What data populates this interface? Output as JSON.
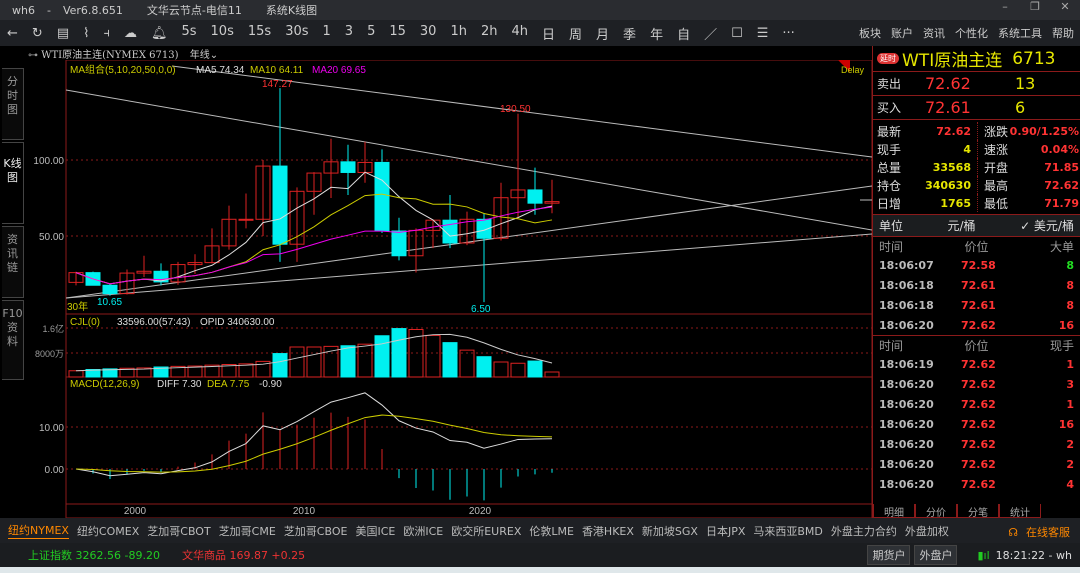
{
  "window": {
    "app": "wh6",
    "version": "Ver6.8.651",
    "server": "文华云节点-电信11",
    "view": "系统K线图"
  },
  "toolbar": {
    "periods": [
      "5s",
      "10s",
      "15s",
      "30s",
      "1",
      "3",
      "5",
      "15",
      "30",
      "1h",
      "2h",
      "4h",
      "日",
      "周",
      "月",
      "季",
      "年",
      "自"
    ],
    "menu": [
      "板块",
      "账户",
      "资讯",
      "个性化",
      "系统工具",
      "帮助"
    ]
  },
  "sidebar": {
    "tabs": [
      "分时图",
      "K线图",
      "资讯链",
      "F10资料"
    ]
  },
  "chart": {
    "symbol": "WTI原油主连(NYMEX 6713)",
    "period": "年线",
    "delay": "Delay",
    "ma_label": "MA组合(5,10,20,50,0,0)",
    "ma5": "MA5 74.34",
    "ma10": "MA10 64.11",
    "ma20": "MA20 69.65",
    "high_label": "147.27",
    "high2_label": "130.50",
    "low_label": "10.65",
    "low2_label": "6.50",
    "span": "30年",
    "y_ticks": [
      "100.00",
      "50.00"
    ],
    "vol_label": "CJL(0)",
    "vol_info": "33596.00(57:43)",
    "opid": "OPID 340630.00",
    "vol_ticks": [
      "1.6亿",
      "8000万"
    ],
    "macd_label": "MACD(12,26,9)",
    "diff": "DIFF 7.30",
    "dea": "DEA 7.75",
    "macd": "-0.90",
    "macd_ticks": [
      "10.00",
      "0.00"
    ],
    "x_ticks": [
      "2000",
      "2010",
      "2020"
    ],
    "colors": {
      "up": "#d22",
      "down": "#00f0f0",
      "ma5": "#ddd",
      "ma10": "#cccc00",
      "ma20": "#e0e"
    }
  },
  "chart_data": {
    "type": "candlestick",
    "years": [
      1996,
      1997,
      1998,
      1999,
      2000,
      2001,
      2002,
      2003,
      2004,
      2005,
      2006,
      2007,
      2008,
      2009,
      2010,
      2011,
      2012,
      2013,
      2014,
      2015,
      2016,
      2017,
      2018,
      2019,
      2020,
      2021,
      2022,
      2023,
      2024
    ],
    "ohlc": [
      [
        19.5,
        26.5,
        17.5,
        25.9
      ],
      [
        25.9,
        26.6,
        17.8,
        17.6
      ],
      [
        17.6,
        18,
        10.65,
        12.1
      ],
      [
        12.1,
        28,
        11.5,
        25.6
      ],
      [
        25.6,
        37,
        23,
        26.8
      ],
      [
        26.8,
        32,
        17.5,
        19.8
      ],
      [
        19.8,
        33,
        17.9,
        31.2
      ],
      [
        31.2,
        38,
        25,
        32.5
      ],
      [
        32.5,
        55,
        32,
        43.5
      ],
      [
        43.5,
        70,
        41,
        61
      ],
      [
        61,
        78,
        55,
        61
      ],
      [
        61,
        100,
        50,
        96
      ],
      [
        96,
        147.27,
        33,
        44.6
      ],
      [
        44.6,
        82,
        33,
        79.4
      ],
      [
        79.4,
        92,
        64,
        91.4
      ],
      [
        91.4,
        114,
        75,
        98.8
      ],
      [
        98.8,
        110,
        77,
        91.8
      ],
      [
        91.8,
        112,
        85,
        98.4
      ],
      [
        98.4,
        107,
        52,
        53.3
      ],
      [
        53.3,
        62,
        34,
        37
      ],
      [
        37,
        55,
        26,
        53.7
      ],
      [
        53.7,
        60,
        42,
        60.4
      ],
      [
        60.4,
        77,
        42,
        45.4
      ],
      [
        45.4,
        66,
        44,
        61
      ],
      [
        61,
        65,
        6.5,
        48.5
      ],
      [
        48.5,
        85,
        47,
        75.2
      ],
      [
        75.2,
        130.5,
        62,
        80.3
      ],
      [
        80.3,
        95,
        64,
        71.6
      ],
      [
        71.6,
        87,
        65,
        72.62
      ]
    ],
    "volume_wan": [
      2000,
      2400,
      2600,
      2800,
      2900,
      3200,
      3400,
      3500,
      3800,
      4000,
      4200,
      5000,
      7500,
      9600,
      9600,
      9800,
      10000,
      10500,
      13200,
      15500,
      15200,
      13300,
      11000,
      8600,
      6500,
      4800,
      4400,
      5100,
      1600
    ]
  },
  "quote": {
    "badge": "延时",
    "name": "WTI原油主连",
    "code": "6713",
    "sell_label": "卖出",
    "sell_price": "72.62",
    "sell_vol": "13",
    "buy_label": "买入",
    "buy_price": "72.61",
    "buy_vol": "6",
    "stats": [
      [
        "最新",
        "72.62",
        "涨跌",
        "0.90/1.25%"
      ],
      [
        "现手",
        "4",
        "速涨",
        "0.04%"
      ],
      [
        "总量",
        "33568",
        "开盘",
        "71.85"
      ],
      [
        "持仓",
        "340630",
        "最高",
        "72.62"
      ],
      [
        "日增",
        "1765",
        "最低",
        "71.79"
      ]
    ],
    "unit_label": "单位",
    "unit1": "元/桶",
    "unit2": "✓ 美元/桶"
  },
  "big_orders": {
    "headers": [
      "时间",
      "价位",
      "大单"
    ],
    "rows": [
      [
        "18:06:07",
        "72.58",
        "8"
      ],
      [
        "18:06:18",
        "72.61",
        "8"
      ],
      [
        "18:06:18",
        "72.61",
        "8"
      ],
      [
        "18:06:20",
        "72.62",
        "16"
      ]
    ]
  },
  "ticks": {
    "headers": [
      "时间",
      "价位",
      "现手"
    ],
    "rows": [
      [
        "18:06:19",
        "72.62",
        "1"
      ],
      [
        "18:06:20",
        "72.62",
        "3"
      ],
      [
        "18:06:20",
        "72.62",
        "1"
      ],
      [
        "18:06:20",
        "72.62",
        "16"
      ],
      [
        "18:06:20",
        "72.62",
        "2"
      ],
      [
        "18:06:20",
        "72.62",
        "2"
      ],
      [
        "18:06:20",
        "72.62",
        "4"
      ]
    ]
  },
  "right_tabs": [
    "明细",
    "分价",
    "分笔",
    "统计"
  ],
  "markets": [
    "纽约NYMEX",
    "纽约COMEX",
    "芝加哥CBOT",
    "芝加哥CME",
    "芝加哥CBOE",
    "美国ICE",
    "欧洲ICE",
    "欧交所EUREX",
    "伦敦LME",
    "香港HKEX",
    "新加坡SGX",
    "日本JPX",
    "马来西亚BMD",
    "外盘主力合约",
    "外盘加权"
  ],
  "service": "在线客服",
  "status": {
    "idx1": "上证指数 3262.56 -89.20",
    "idx2": "文华商品 169.87 +0.25",
    "btn1": "期货户",
    "btn2": "外盘户",
    "time": "18:21:22 - wh"
  }
}
